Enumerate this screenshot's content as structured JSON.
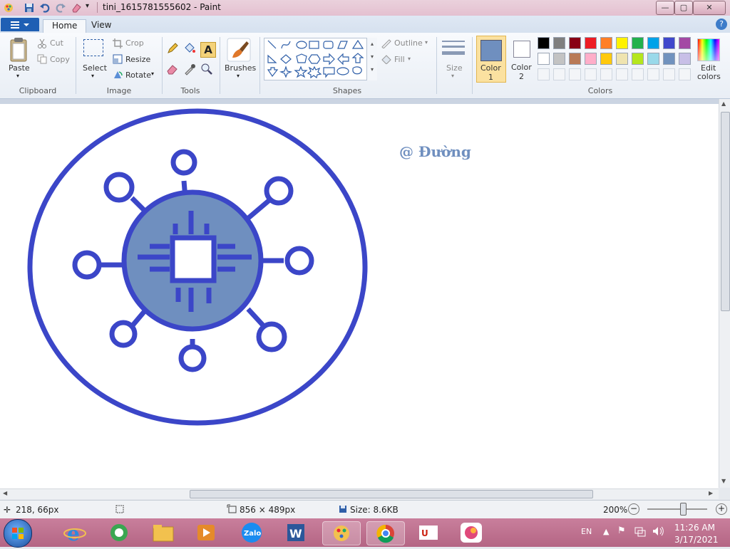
{
  "window": {
    "title": "tini_1615781555602 - Paint",
    "controls": {
      "minimize": "—",
      "maximize": "▢",
      "close": "✕"
    }
  },
  "tabs": [
    {
      "label": "Home",
      "active": true
    },
    {
      "label": "View",
      "active": false
    }
  ],
  "ribbon": {
    "clipboard": {
      "group": "Clipboard",
      "paste": "Paste",
      "cut": "Cut",
      "copy": "Copy"
    },
    "image": {
      "group": "Image",
      "select": "Select",
      "crop": "Crop",
      "resize": "Resize",
      "rotate": "Rotate"
    },
    "tools": {
      "group": "Tools"
    },
    "brushes": {
      "label": "Brushes"
    },
    "shapes": {
      "group": "Shapes",
      "outline": "Outline",
      "fill": "Fill"
    },
    "size": {
      "label": "Size"
    },
    "color1": {
      "label": "Color",
      "num": "1",
      "value": "#6f8fbf"
    },
    "color2": {
      "label": "Color",
      "num": "2",
      "value": "#ffffff"
    },
    "colors": {
      "group": "Colors"
    },
    "edit_colors": {
      "line1": "Edit",
      "line2": "colors"
    }
  },
  "palette": {
    "row1": [
      "#000000",
      "#7f7f7f",
      "#880015",
      "#ed1c24",
      "#ff7f27",
      "#fff200",
      "#22b14c",
      "#00a2e8",
      "#3f48cc",
      "#a349a4"
    ],
    "row2": [
      "#ffffff",
      "#c3c3c3",
      "#b97a57",
      "#ffaec9",
      "#ffc90e",
      "#efe4b0",
      "#b5e61d",
      "#99d9ea",
      "#7092be",
      "#c8bfe7"
    ]
  },
  "canvas": {
    "watermark": "@ Đường",
    "accent": "#3b46c8",
    "fill": "#6f8fbf"
  },
  "status": {
    "cursor_pos": "218, 66px",
    "dimensions": "856 × 489px",
    "size": "Size: 8.6KB",
    "zoom": "200%",
    "zoom_fraction": 0.6
  },
  "taskbar": {
    "language": "EN",
    "time": "11:26 AM",
    "date": "3/17/2021"
  }
}
